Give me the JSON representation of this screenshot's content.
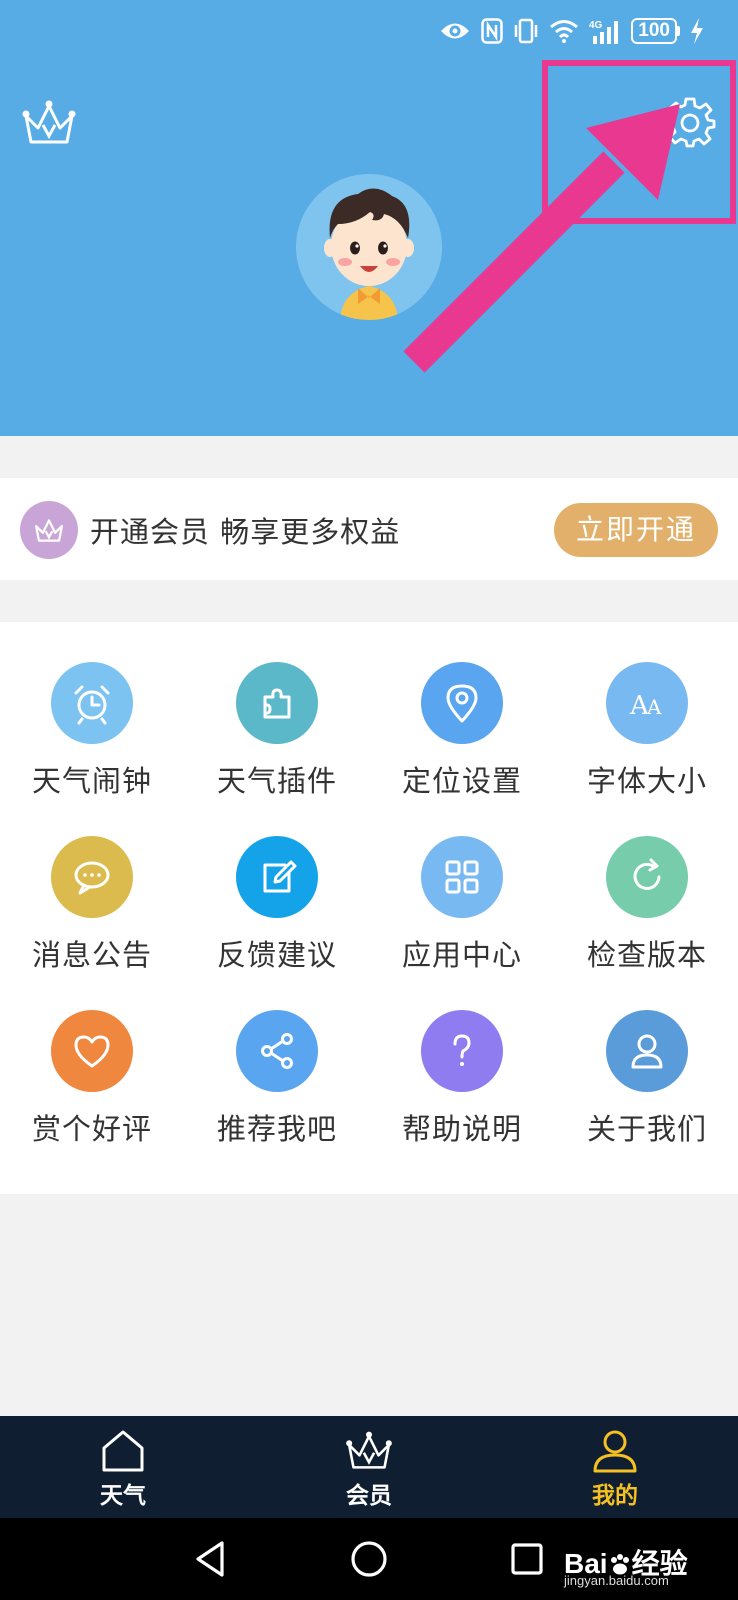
{
  "status_bar": {
    "battery": "100",
    "network": "4G",
    "icons": [
      "eye-icon",
      "nfc-icon",
      "vibrate-icon",
      "wifi-icon",
      "signal-icon",
      "battery-icon",
      "charging-icon"
    ]
  },
  "header": {
    "background": "#58ace6",
    "left_icon": "crown-icon",
    "right_icon": "gear-icon",
    "avatar": "cartoon-boy-avatar"
  },
  "annotation": {
    "color": "#e8388f",
    "shapes": [
      "highlight-box",
      "pointer-arrow"
    ]
  },
  "vip_banner": {
    "icon": "crown-icon",
    "text": "开通会员 畅享更多权益",
    "button_label": "立即开通",
    "button_color": "#e2b06a"
  },
  "grid": {
    "items": [
      {
        "label": "天气闹钟",
        "icon": "alarm-clock-icon",
        "color": "#7cc3f1"
      },
      {
        "label": "天气插件",
        "icon": "puzzle-icon",
        "color": "#5bb8c9"
      },
      {
        "label": "定位设置",
        "icon": "location-pin-icon",
        "color": "#5aa5ef"
      },
      {
        "label": "字体大小",
        "icon": "font-size-icon",
        "color": "#79b9f2"
      },
      {
        "label": "消息公告",
        "icon": "chat-bubble-icon",
        "color": "#dcbb4e"
      },
      {
        "label": "反馈建议",
        "icon": "edit-icon",
        "color": "#14a3e8"
      },
      {
        "label": "应用中心",
        "icon": "app-grid-icon",
        "color": "#79b9f2"
      },
      {
        "label": "检查版本",
        "icon": "refresh-icon",
        "color": "#77ccab"
      },
      {
        "label": "赏个好评",
        "icon": "heart-icon",
        "color": "#f0873f"
      },
      {
        "label": "推荐我吧",
        "icon": "share-icon",
        "color": "#5aa5ef"
      },
      {
        "label": "帮助说明",
        "icon": "question-icon",
        "color": "#8f7cf1"
      },
      {
        "label": "关于我们",
        "icon": "user-icon",
        "color": "#5a9bd9"
      }
    ]
  },
  "tabbar": {
    "tabs": [
      {
        "label": "天气",
        "icon": "home-icon",
        "active": false
      },
      {
        "label": "会员",
        "icon": "crown-icon",
        "active": false
      },
      {
        "label": "我的",
        "icon": "user-icon",
        "active": true
      }
    ],
    "active_color": "#f5c022"
  },
  "system_nav": {
    "buttons": [
      "back-icon",
      "home-circle-icon",
      "recents-icon"
    ],
    "watermark": {
      "brand": "Bai",
      "brand_tail": "经验",
      "url": "jingyan.baidu.com"
    }
  }
}
